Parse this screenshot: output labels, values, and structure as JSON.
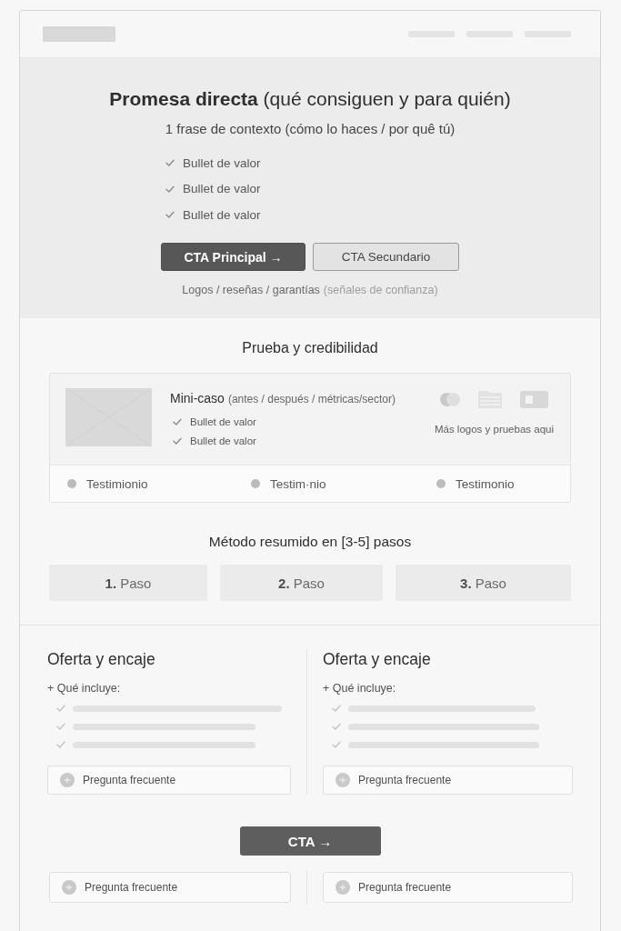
{
  "hero": {
    "title": "**Promesa directa** (qué consiguen y para quién)",
    "subtitle": "1 frase de contexto (cómo lo haces / por quê tú)",
    "bullets": [
      "Bullet de valor",
      "Bullet de valor",
      "Bullet de valor"
    ],
    "buttons": [
      {
        "label": "CTA Principal →",
        "kind": "primary"
      },
      {
        "label": "CTA Secundario",
        "kind": "secondary"
      }
    ],
    "trust": {
      "text": "Logos / reseñas / garantías",
      "note": "(señales de confianza)"
    }
  },
  "proof": {
    "title": "Prueba y credibilidad",
    "case": {
      "title": "Mini-caso",
      "note": "(antes / después / métricas/sector)",
      "bullets": [
        "Bullet de valor",
        "Bullet de valor"
      ]
    },
    "logos_caption": "Más logos y pruebas aqui",
    "testimonials": [
      "Testimionio",
      "Testim·nio",
      "Testimonio"
    ]
  },
  "method": {
    "title": "Método resumido en [3-5] pasos",
    "steps": [
      "**1.** Paso",
      "**2.** Paso",
      "**3.** Paso"
    ]
  },
  "offers": [
    {
      "title": "Oferta y encaje",
      "includes_label": "+ Qué incluye:",
      "faq": "Pregunta frecuente"
    },
    {
      "title": "Oferta y encaje",
      "includes_label": "+ Qué incluye:",
      "faq": "Pregunta frecuente"
    }
  ],
  "cta": {
    "label": "CTA →"
  },
  "faqs": [
    "Pregunta frecuente",
    "Pregunta frecuente"
  ]
}
